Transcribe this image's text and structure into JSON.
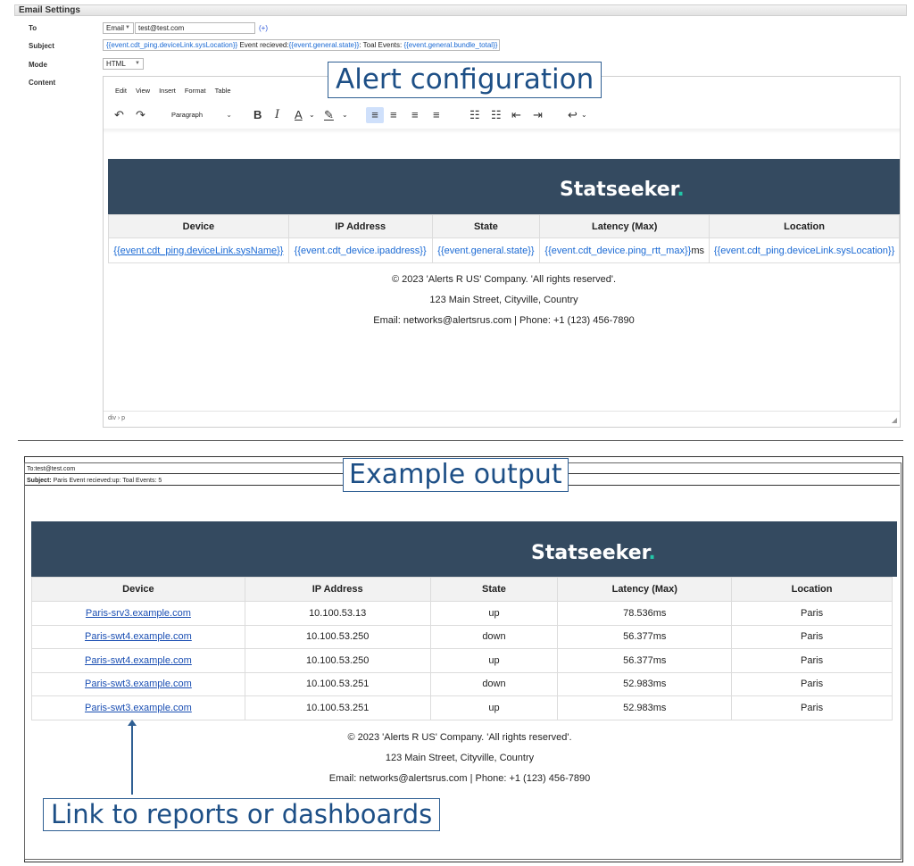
{
  "settings": {
    "title": "Email Settings",
    "to_label": "To",
    "to_type": "Email",
    "to_value": "test@test.com",
    "add_link": "(+)",
    "subject_label": "Subject",
    "subject_parts": [
      {
        "t": "{{event.cdt_ping.deviceLink.sysLocation}}",
        "token": true
      },
      {
        "t": " Event recieved:",
        "token": false
      },
      {
        "t": "{{event.general.state}}",
        "token": true
      },
      {
        "t": ": Toal Events: ",
        "token": false
      },
      {
        "t": "{{event.general.bundle_total}}",
        "token": true
      }
    ],
    "mode_label": "Mode",
    "mode_value": "HTML",
    "content_label": "Content"
  },
  "editor": {
    "menus": [
      "Edit",
      "View",
      "Insert",
      "Format",
      "Table"
    ],
    "block_format": "Paragraph",
    "status_path": "div › p",
    "icons": {
      "undo": "↶",
      "redo": "↷",
      "bold": "B",
      "italic": "I",
      "underline": "A",
      "highlight": "✎",
      "align_left": "≡",
      "align_center": "≡",
      "align_right": "≡",
      "justify": "≡",
      "bullet_list": "☷",
      "numbered_list": "☷",
      "outdent": "⇤",
      "indent": "⇥",
      "ltr": "↩"
    }
  },
  "template": {
    "brand": "Statseeker",
    "brand_dot": ".",
    "headers": [
      "Device",
      "IP Address",
      "State",
      "Latency (Max)",
      "Location"
    ],
    "row": [
      {
        "t": "{{event.cdt_ping.deviceLink.sysName}}",
        "link": true
      },
      {
        "t": "{{event.cdt_device.ipaddress}}",
        "link": false
      },
      {
        "t": "{{event.general.state}}",
        "link": false
      },
      {
        "t": "{{event.cdt_device.ping_rtt_max}}",
        "suffix": "ms",
        "link": false
      },
      {
        "t": "{{event.cdt_ping.deviceLink.sysLocation}}",
        "link": false
      }
    ],
    "footer": [
      "© 2023 'Alerts R US' Company. 'All rights reserved'.",
      "123 Main Street, Cityville, Country",
      "Email: networks@alertsrus.com | Phone: +1 (123) 456-7890"
    ]
  },
  "output": {
    "to_label": "To:",
    "to_value": "test@test.com",
    "subject_label": "Subject:",
    "subject_value": " Paris Event recieved:up: Toal Events: 5",
    "brand": "Statseeker",
    "brand_dot": ".",
    "headers": [
      "Device",
      "IP Address",
      "State",
      "Latency (Max)",
      "Location"
    ],
    "rows": [
      [
        "Paris-srv3.example.com",
        "10.100.53.13",
        "up",
        "78.536ms",
        "Paris"
      ],
      [
        "Paris-swt4.example.com",
        "10.100.53.250",
        "down",
        "56.377ms",
        "Paris"
      ],
      [
        "Paris-swt4.example.com",
        "10.100.53.250",
        "up",
        "56.377ms",
        "Paris"
      ],
      [
        "Paris-swt3.example.com",
        "10.100.53.251",
        "down",
        "52.983ms",
        "Paris"
      ],
      [
        "Paris-swt3.example.com",
        "10.100.53.251",
        "up",
        "52.983ms",
        "Paris"
      ]
    ],
    "footer": [
      "© 2023 'Alerts R US' Company. 'All rights reserved'.",
      "123 Main Street, Cityville, Country",
      "Email: networks@alertsrus.com | Phone: +1 (123) 456-7890"
    ]
  },
  "callouts": {
    "alert": "Alert configuration",
    "example": "Example output",
    "link": "Link to reports or dashboards"
  },
  "colors": {
    "banner": "#344a60",
    "brand_dot": "#23c6a8",
    "callout": "#2f5f93",
    "token": "#1b6ad4"
  }
}
